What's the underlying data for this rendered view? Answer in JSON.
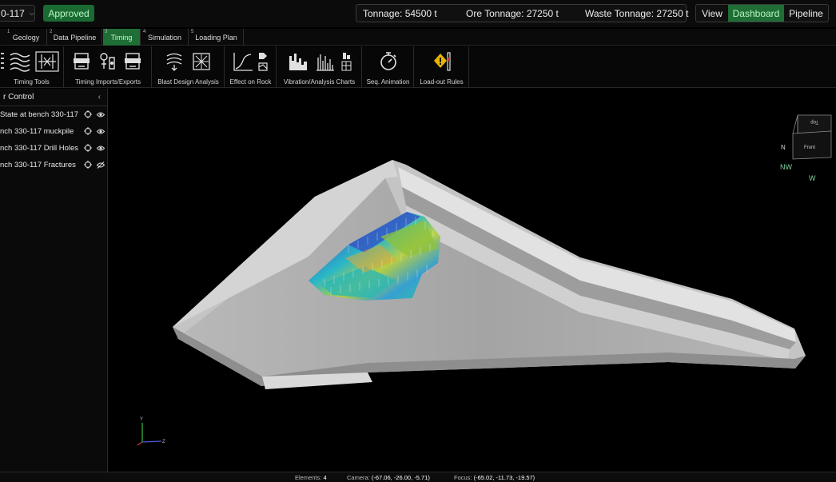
{
  "header": {
    "bench_value": "0-117",
    "status": "Approved",
    "tonnage": "Tonnage: 54500 t",
    "ore_tonnage": "Ore Tonnage: 27250 t",
    "waste_tonnage": "Waste Tonnage: 27250 t",
    "modes": [
      "View",
      "Dashboard",
      "Pipeline"
    ],
    "active_mode": "Dashboard"
  },
  "tabs": [
    {
      "num": "1",
      "label": "Geology"
    },
    {
      "num": "2",
      "label": "Data Pipeline"
    },
    {
      "num": "3",
      "label": "Timing",
      "active": true
    },
    {
      "num": "4",
      "label": "Simulation"
    },
    {
      "num": "5",
      "label": "Loading Plan"
    }
  ],
  "ribbon": {
    "groups": [
      "Timing Tools",
      "Timing Imports/Exports",
      "Blast Design Analysis",
      "Effect on Rock",
      "Vibration/Analysis Charts",
      "Seq. Animation",
      "Load-out Rules"
    ]
  },
  "panel": {
    "title": "r Control",
    "layers": [
      {
        "label": "State at bench 330-117",
        "visible": true
      },
      {
        "label": "nch 330-117 muckpile",
        "visible": true
      },
      {
        "label": "nch 330-117 Drill Holes",
        "visible": true
      },
      {
        "label": "nch 330-117 Fractures",
        "visible": false
      }
    ]
  },
  "viewport": {
    "compass": {
      "n": "N",
      "nw": "NW",
      "w": "W"
    },
    "cube": {
      "top": "Top",
      "front": "Front"
    },
    "axes": {
      "y": "Y",
      "z": "Z"
    }
  },
  "status": {
    "elements_label": "Elements:",
    "elements_value": "4",
    "camera_label": "Camera:",
    "camera_value": "(-67.06, -26.00, -5.71)",
    "focus_label": "Focus:",
    "focus_value": "(-65.02, -11.73, -19.57)"
  },
  "colors": {
    "accent_green": "#1f6e35",
    "pit_grey": "#9a9a9a",
    "heatmap": [
      "#2a3fb8",
      "#1ea8d6",
      "#2fd08a",
      "#b6d63a",
      "#e59a2c"
    ]
  }
}
